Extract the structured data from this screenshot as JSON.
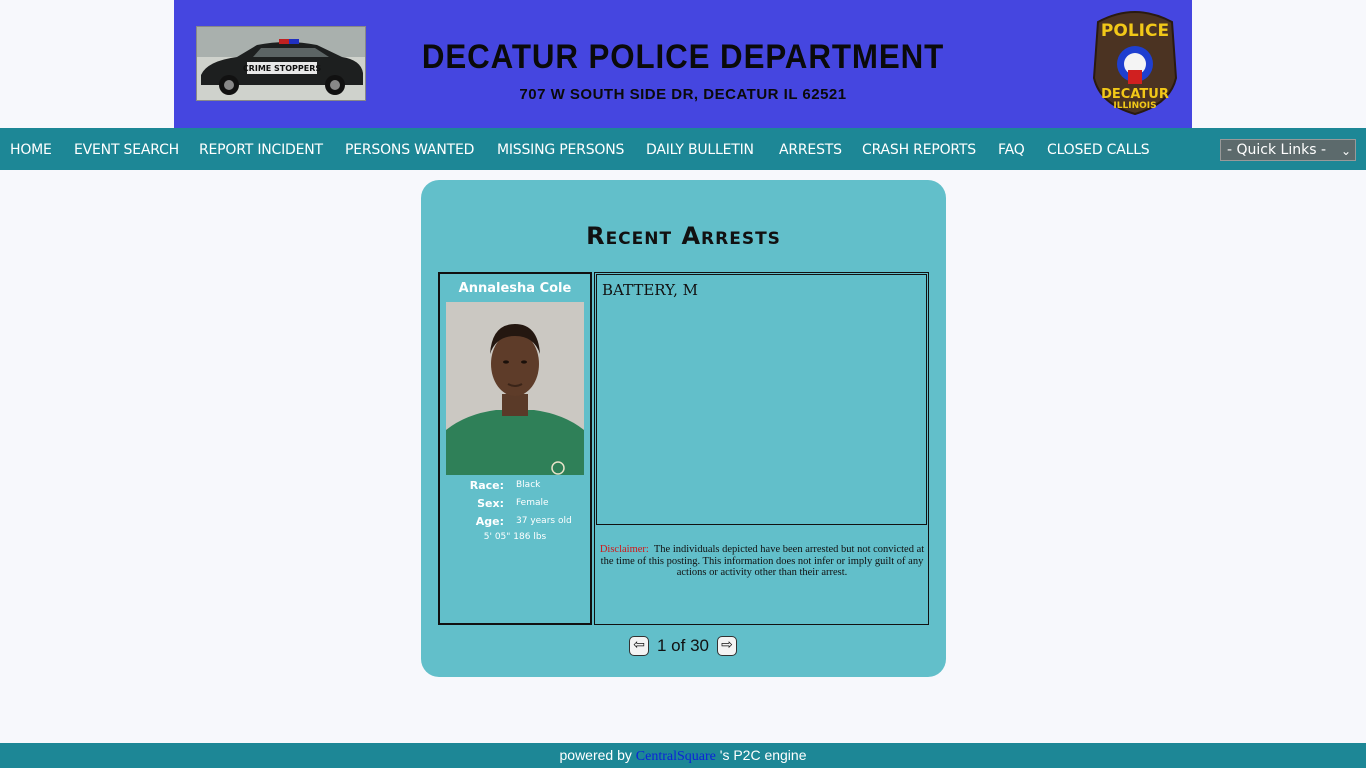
{
  "banner": {
    "title": "DECATUR POLICE DEPARTMENT",
    "address": "707 W SOUTH SIDE DR, DECATUR IL 62521",
    "car_text": "CRIME STOPPERS",
    "badge_top": "POLICE",
    "badge_bottom_1": "DECATUR",
    "badge_bottom_2": "ILLINOIS"
  },
  "nav": {
    "items": [
      {
        "label": "HOME"
      },
      {
        "label": "EVENT SEARCH"
      },
      {
        "label": "REPORT INCIDENT"
      },
      {
        "label": "PERSONS WANTED"
      },
      {
        "label": "MISSING PERSONS"
      },
      {
        "label": "DAILY BULLETIN"
      },
      {
        "label": "ARRESTS"
      },
      {
        "label": "CRASH REPORTS"
      },
      {
        "label": "FAQ"
      },
      {
        "label": "CLOSED CALLS"
      }
    ],
    "quick_links": "- Quick Links -"
  },
  "panel": {
    "title": "Recent Arrests",
    "person": {
      "name": "Annalesha Cole",
      "race_label": "Race:",
      "race": "Black",
      "sex_label": "Sex:",
      "sex": "Female",
      "age_label": "Age:",
      "age": "37 years old",
      "height_weight": "5' 05\" 186 lbs"
    },
    "charge": "BATTERY, M",
    "disclaimer_label": "Disclaimer:",
    "disclaimer_text": "The individuals depicted have been arrested but not convicted at the time of this posting.   This information does not infer or imply guilt of any actions or activity other than their arrest.",
    "pager": {
      "prev_icon": "arrow-left-icon",
      "next_icon": "arrow-right-icon",
      "text": "1 of 30"
    }
  },
  "footer": {
    "prefix": "powered by ",
    "link": "CentralSquare",
    "suffix": " 's P2C engine"
  },
  "colors": {
    "banner": "#4546e0",
    "nav": "#1d8796",
    "panel": "#62bfca",
    "disclaimer_label": "#d01818",
    "footer_link": "#0b23d8"
  }
}
